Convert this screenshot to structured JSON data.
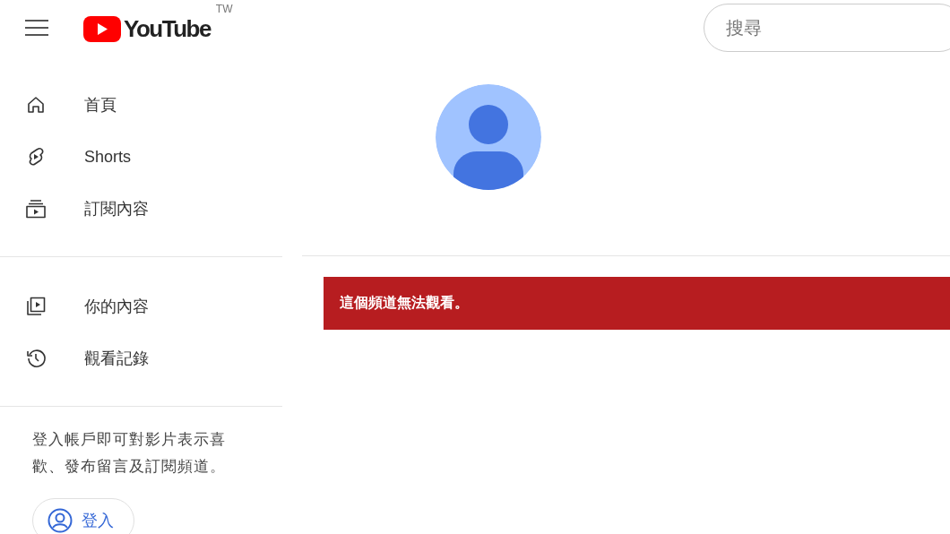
{
  "header": {
    "logo": {
      "wordmark": "YouTube",
      "region": "TW"
    },
    "search": {
      "placeholder": "搜尋"
    }
  },
  "sidebar": {
    "sections": [
      {
        "items": [
          {
            "kind": "home",
            "label": "首頁"
          },
          {
            "kind": "shorts",
            "label": "Shorts"
          },
          {
            "kind": "subscriptions",
            "label": "訂閱內容"
          }
        ]
      },
      {
        "items": [
          {
            "kind": "library",
            "label": "你的內容"
          },
          {
            "kind": "history",
            "label": "觀看記錄"
          }
        ]
      }
    ],
    "signin_prompt": "登入帳戶即可對影片表示喜歡、發布留言及訂閱頻道。",
    "signin_button": "登入"
  },
  "channel": {
    "error_message": "這個頻道無法觀看。"
  }
}
